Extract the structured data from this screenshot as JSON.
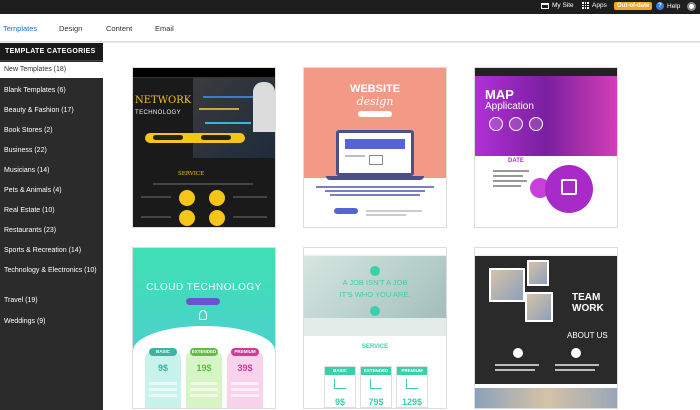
{
  "topbar": {
    "my_site": "My Site",
    "apps": "Apps",
    "badge": "Out-of-date",
    "help": "Help"
  },
  "nav": {
    "tabs": [
      "Templates",
      "Design",
      "Content",
      "Email"
    ]
  },
  "sidebar": {
    "header": "TEMPLATE CATEGORIES",
    "categories": [
      "New Templates (18)",
      "Blank Templates (6)",
      "Beauty & Fashion (17)",
      "Book Stores (2)",
      "Business (22)",
      "Musicians (14)",
      "Pets & Animals (4)",
      "Real Estate (10)",
      "Restaurants (23)",
      "Sports & Recreation (14)",
      "Technology & Electronics (10)",
      "Travel (19)",
      "Weddings (9)"
    ]
  },
  "cards": {
    "network": {
      "title": "NETWORK",
      "subtitle": "TECHNOLOGY",
      "section": "SERVICE"
    },
    "website": {
      "title": "WEBSITE",
      "subtitle": "design"
    },
    "map": {
      "title": "MAP",
      "subtitle": "Application",
      "section": "DATE"
    },
    "cloud": {
      "title": "CLOUD TECHNOLOGY",
      "tiers": [
        {
          "name": "BASIC",
          "price": "9$"
        },
        {
          "name": "EXTENDED",
          "price": "19$"
        },
        {
          "name": "PREMIUM",
          "price": "39$"
        }
      ]
    },
    "job": {
      "line1": "A JOB ISN'T A JOB",
      "line2": "IT'S WHO YOU ARE.",
      "section": "SERVICE",
      "tiers": [
        {
          "name": "BASIC",
          "price": "9$"
        },
        {
          "name": "EXTENDED",
          "price": "79$"
        },
        {
          "name": "PREMIUM",
          "price": "129$"
        }
      ]
    },
    "team": {
      "title1": "TEAM",
      "title2": "WORK",
      "section": "ABOUT US"
    }
  },
  "colors": {
    "accent": "#1c72c9",
    "badge": "#f5a623",
    "sidebar_bg": "#2b2b2b",
    "network_yellow": "#f3c21a",
    "website_coral": "#f39a86",
    "map_purple": "#b130d6",
    "cloud_mint": "#3ee0b3",
    "job_teal": "#3ad0aa"
  }
}
